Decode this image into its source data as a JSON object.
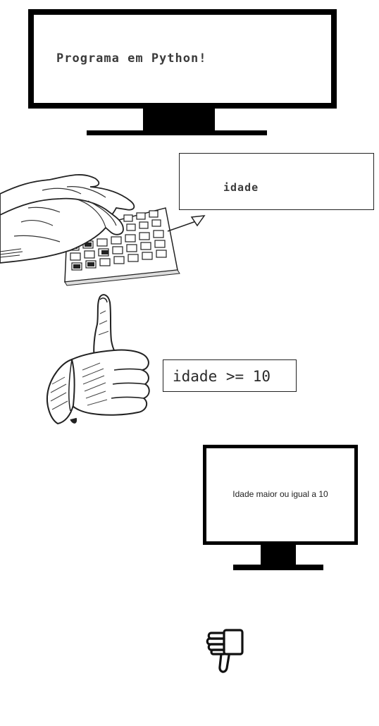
{
  "monitor_top": {
    "text": "Programa em Python!"
  },
  "input_box": {
    "text": "idade"
  },
  "condition_box": {
    "text": "idade >= 10"
  },
  "monitor_bottom": {
    "text": "Idade maior ou igual a 10"
  },
  "colors": {
    "ink": "#000000",
    "background": "#ffffff",
    "text": "#3b3b3b"
  },
  "icons": [
    "hands-typing-on-keyboard-illustration",
    "thumbs-up-hand-illustration",
    "thumbs-down-icon",
    "arrow-icon",
    "monitor-icon"
  ]
}
